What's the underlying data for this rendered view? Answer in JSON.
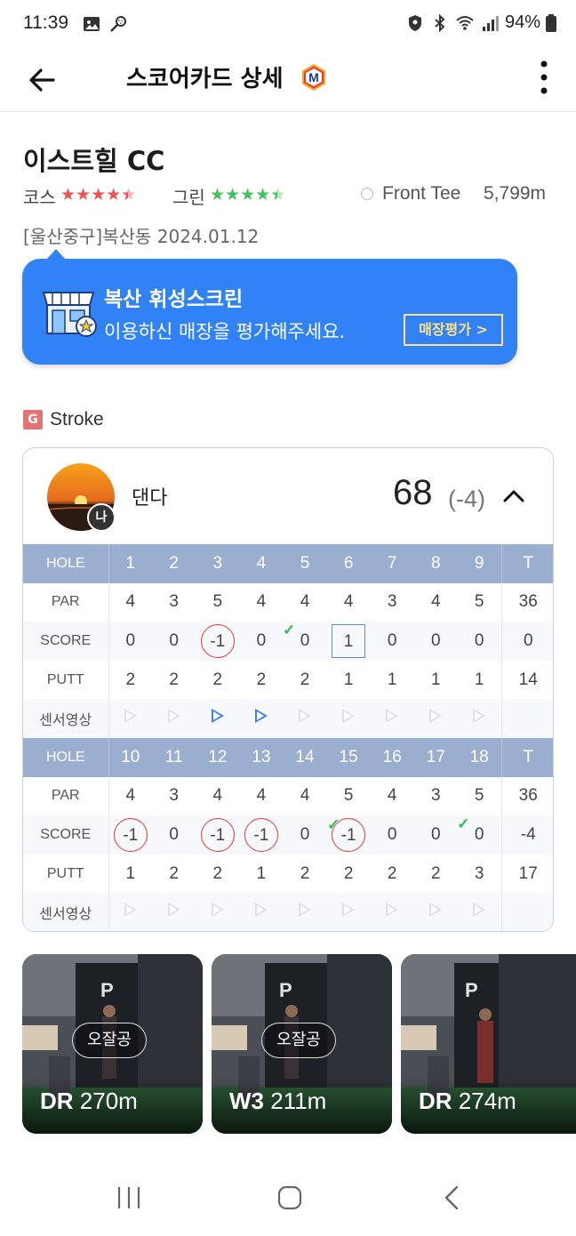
{
  "status_bar": {
    "time": "11:39",
    "battery": "94%"
  },
  "header": {
    "title": "스코어카드 상세",
    "brand_letter": "M"
  },
  "course": {
    "name": "이스트힐 CC",
    "course_rating_label": "코스",
    "course_rating": 4.5,
    "green_rating_label": "그린",
    "green_rating": 4.5,
    "tee": "Front Tee",
    "length": "5,799m",
    "location_date": "[울산중구]복산동 2024.01.12"
  },
  "store_banner": {
    "title": "복산 휘성스크린",
    "subtitle": "이용하신 매장을 평가해주세요.",
    "button_label": "매장평가 >"
  },
  "game_type": {
    "badge": "G",
    "label": "Stroke"
  },
  "player": {
    "name": "댄다",
    "badge": "나",
    "total_score": "68",
    "total_diff": "(-4)"
  },
  "labels": {
    "hole": "HOLE",
    "par": "PAR",
    "score": "SCORE",
    "putt": "PUTT",
    "video": "센서영상",
    "total": "T"
  },
  "front_nine": {
    "holes": [
      "1",
      "2",
      "3",
      "4",
      "5",
      "6",
      "7",
      "8",
      "9"
    ],
    "par": [
      "4",
      "3",
      "5",
      "4",
      "4",
      "4",
      "3",
      "4",
      "5"
    ],
    "par_total": "36",
    "score": [
      "0",
      "0",
      "-1",
      "0",
      "0",
      "1",
      "0",
      "0",
      "0"
    ],
    "score_marks": [
      "",
      "",
      "circle",
      "",
      "check",
      "box",
      "",
      "",
      ""
    ],
    "score_total": "0",
    "putt": [
      "2",
      "2",
      "2",
      "2",
      "2",
      "1",
      "1",
      "1",
      "1"
    ],
    "putt_total": "14",
    "video": [
      false,
      false,
      true,
      true,
      false,
      false,
      false,
      false,
      false
    ]
  },
  "back_nine": {
    "holes": [
      "10",
      "11",
      "12",
      "13",
      "14",
      "15",
      "16",
      "17",
      "18"
    ],
    "par": [
      "4",
      "3",
      "4",
      "4",
      "4",
      "5",
      "4",
      "3",
      "5"
    ],
    "par_total": "36",
    "score": [
      "-1",
      "0",
      "-1",
      "-1",
      "0",
      "-1",
      "0",
      "0",
      "0"
    ],
    "score_marks": [
      "circle",
      "",
      "circle",
      "circle",
      "",
      "circle-check",
      "",
      "",
      "check"
    ],
    "score_total": "-4",
    "putt": [
      "1",
      "2",
      "2",
      "1",
      "2",
      "2",
      "2",
      "2",
      "3"
    ],
    "putt_total": "17",
    "video": [
      false,
      false,
      false,
      false,
      false,
      false,
      false,
      false,
      false
    ]
  },
  "shots": [
    {
      "tag": "오잘공",
      "club": "DR",
      "distance": "270m"
    },
    {
      "tag": "오잘공",
      "club": "W3",
      "distance": "211m"
    },
    {
      "tag": "",
      "club": "DR",
      "distance": "274m"
    }
  ],
  "colors": {
    "accent_blue": "#3182f6",
    "hole_header": "#9aaed0",
    "star_red": "#ef5350",
    "star_green": "#43c35e",
    "under_par_circle": "#e53935"
  }
}
